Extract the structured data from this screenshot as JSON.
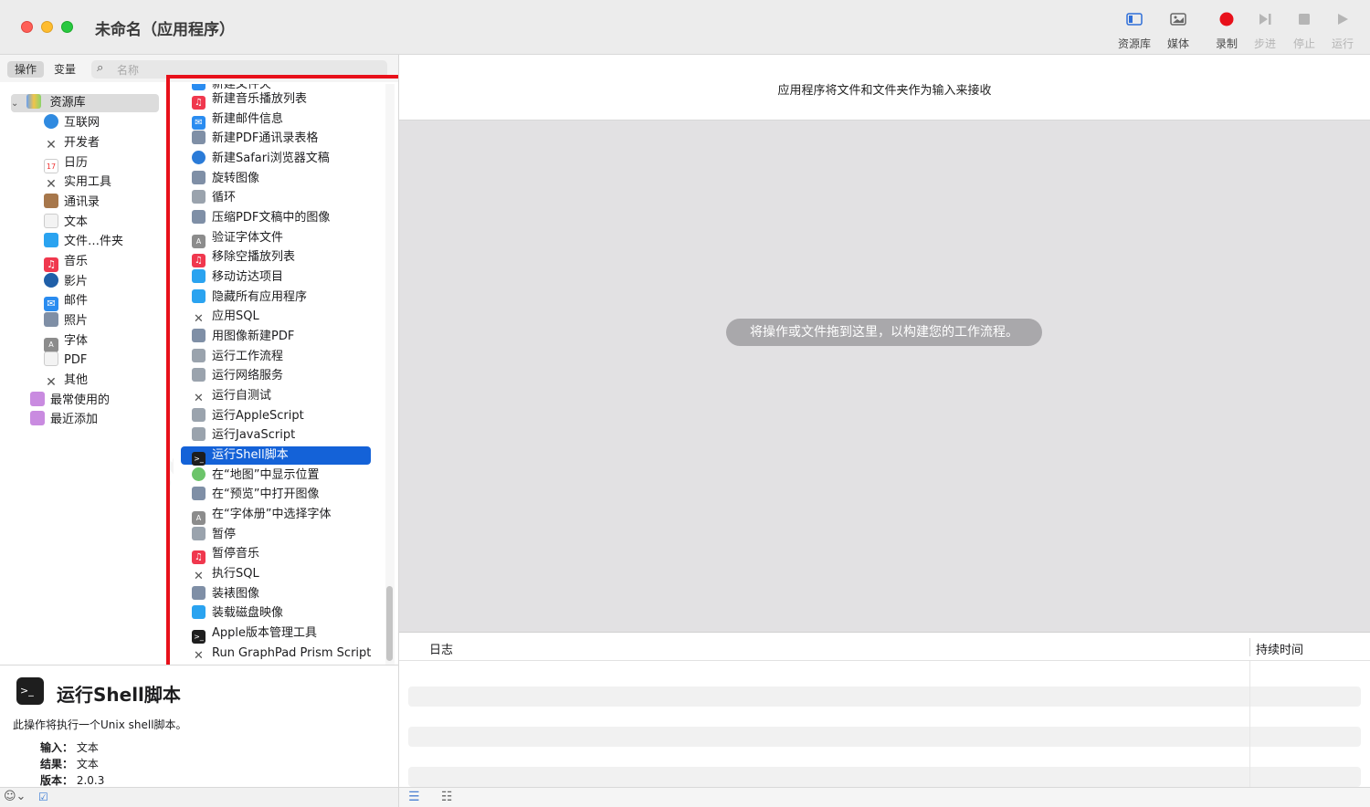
{
  "window": {
    "title": "未命名（应用程序）"
  },
  "toolbar": {
    "library": "资源库",
    "media": "媒体",
    "record": "录制",
    "step": "步进",
    "stop": "停止",
    "run": "运行"
  },
  "left_tabs": {
    "actions": "操作",
    "variables": "变量"
  },
  "search": {
    "placeholder": "名称"
  },
  "library": {
    "root": "资源库",
    "items": [
      "互联网",
      "开发者",
      "日历",
      "实用工具",
      "通讯录",
      "文本",
      "文件…件夹",
      "音乐",
      "影片",
      "邮件",
      "照片",
      "字体",
      "PDF",
      "其他"
    ],
    "smart": [
      "最常使用的",
      "最近添加"
    ]
  },
  "actions": {
    "cut_top": "新建文件夹",
    "items": [
      "新建音乐播放列表",
      "新建邮件信息",
      "新建PDF通讯录表格",
      "新建Safari浏览器文稿",
      "旋转图像",
      "循环",
      "压缩PDF文稿中的图像",
      "验证字体文件",
      "移除空播放列表",
      "移动访达项目",
      "隐藏所有应用程序",
      "应用SQL",
      "用图像新建PDF",
      "运行工作流程",
      "运行网络服务",
      "运行自测试",
      "运行AppleScript",
      "运行JavaScript",
      "运行Shell脚本",
      "在“地图”中显示位置",
      "在“预览”中打开图像",
      "在“字体册”中选择字体",
      "暂停",
      "暂停音乐",
      "执行SQL",
      "装裱图像",
      "装载磁盘映像",
      "Apple版本管理工具",
      "Run GraphPad Prism Script"
    ],
    "selected": "运行Shell脚本"
  },
  "description": {
    "title": "运行Shell脚本",
    "text": "此操作将执行一个Unix shell脚本。",
    "input_label": "输入：",
    "input_value": "文本",
    "result_label": "结果：",
    "result_value": "文本",
    "version_label": "版本：",
    "version_value": "2.0.3"
  },
  "workflow": {
    "input_banner": "应用程序将文件和文件夹作为输入来接收",
    "drop_hint": "将操作或文件拖到这里，以构建您的工作流程。"
  },
  "log": {
    "col_log": "日志",
    "col_duration": "持续时间"
  },
  "colors": {
    "selection": "#1462d8",
    "highlight_box": "#e8101a",
    "record": "#e8101a"
  }
}
